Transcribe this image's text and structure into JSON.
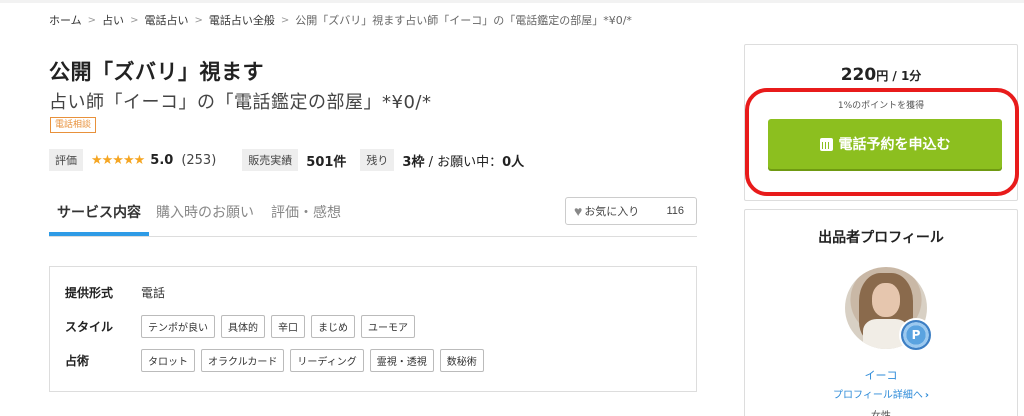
{
  "breadcrumb": {
    "items": [
      "ホーム",
      "占い",
      "電話占い",
      "電話占い全般"
    ],
    "current": "公開「ズバリ」視ます占い師「イーコ」の「電話鑑定の部屋」*¥0/*"
  },
  "service": {
    "title": "公開「ズバリ」視ます",
    "subtitle": "占い師「イーコ」の「電話鑑定の部屋」*¥0/*",
    "category_tag": "電話相談"
  },
  "stats": {
    "rating_label": "評価",
    "stars": "★★★★★",
    "rating_value": "5.0",
    "rating_count": "(253)",
    "sales_label": "販売実績",
    "sales_value": "501件",
    "remaining_label": "残り",
    "remaining_slots": "3枠",
    "remaining_text": " / お願い中：",
    "requests_value": "0人"
  },
  "tabs": [
    {
      "label": "サービス内容",
      "active": true
    },
    {
      "label": "購入時のお願い",
      "active": false
    },
    {
      "label": "評価・感想",
      "active": false
    }
  ],
  "favorite": {
    "label": "お気に入り",
    "count": "116"
  },
  "details": {
    "format_label": "提供形式",
    "format_value": "電話",
    "style_label": "スタイル",
    "style_chips": [
      "テンポが良い",
      "具体的",
      "辛口",
      "まじめ",
      "ユーモア"
    ],
    "method_label": "占術",
    "method_chips": [
      "タロット",
      "オラクルカード",
      "リーディング",
      "霊視・透視",
      "数秘術"
    ]
  },
  "purchase": {
    "price": "220",
    "price_unit": "円 / 1分",
    "point_note": "1%のポイントを獲得",
    "button_label": "電話予約を申込む"
  },
  "profile": {
    "heading": "出品者プロフィール",
    "badge": "P",
    "seller_name": "イーコ",
    "link_label": "プロフィール詳細へ",
    "link_chevron": "›",
    "gender": "女性"
  },
  "colors": {
    "accent_green": "#8cbf1f",
    "link_blue": "#2e8bd8",
    "tab_underline": "#2e9be6",
    "highlight_red": "#e81b1b",
    "star": "#f5a623",
    "tag_orange": "#e8913b"
  }
}
